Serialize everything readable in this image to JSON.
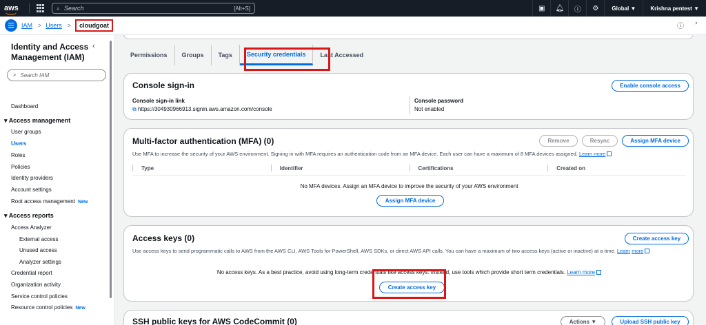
{
  "topbar": {
    "logo": "aws",
    "search_placeholder": "Search",
    "search_shortcut": "[Alt+S]",
    "region": "Global ▼",
    "account": "Krishna pentest ▼",
    "icons": [
      "terminal-icon",
      "bell-icon",
      "help-icon",
      "gear-icon"
    ]
  },
  "breadcrumb": {
    "items": [
      "IAM",
      "Users"
    ],
    "current": "cloudgoat",
    "separator": ">"
  },
  "sidebar": {
    "title": "Identity and Access Management (IAM)",
    "search_placeholder": "Search IAM",
    "dashboard": "Dashboard",
    "access_management": "Access management",
    "user_groups": "User groups",
    "users": "Users",
    "roles": "Roles",
    "policies": "Policies",
    "identity_providers": "Identity providers",
    "account_settings": "Account settings",
    "root_access": "Root access management",
    "new_badge": "New",
    "access_reports": "Access reports",
    "access_analyzer": "Access Analyzer",
    "external_access": "External access",
    "unused_access": "Unused access",
    "analyzer_settings": "Analyzer settings",
    "credential_report": "Credential report",
    "organization_activity": "Organization activity",
    "service_control_policies": "Service control policies",
    "resource_control_policies": "Resource control policies"
  },
  "tabs": [
    "Permissions",
    "Groups",
    "Tags",
    "Security credentials",
    "Last Accessed"
  ],
  "console": {
    "title": "Console sign-in",
    "enable_button": "Enable console access",
    "link_label": "Console sign-in link",
    "link_value": "https://304930966913.signin.aws.amazon.com/console",
    "password_label": "Console password",
    "password_value": "Not enabled"
  },
  "mfa": {
    "title": "Multi-factor authentication (MFA) (0)",
    "remove_button": "Remove",
    "resync_button": "Resync",
    "assign_button": "Assign MFA device",
    "description": "Use MFA to increase the security of your AWS environment. Signing in with MFA requires an authentication code from an MFA device. Each user can have a maximum of 8 MFA devices assigned.",
    "learn_more": "Learn more",
    "columns": [
      "Type",
      "Identifier",
      "Certifications",
      "Created on"
    ],
    "empty_text": "No MFA devices. Assign an MFA device to improve the security of your AWS environment",
    "empty_button": "Assign MFA device"
  },
  "access_keys": {
    "title": "Access keys (0)",
    "create_button": "Create access key",
    "description": "Use access keys to send programmatic calls to AWS from the AWS CLI, AWS Tools for PowerShell, AWS SDKs, or direct AWS API calls. You can have a maximum of two access keys (active or inactive) at a time.",
    "learn_more_1": "Learn",
    "learn_more_2": "more",
    "empty_text": "No access keys. As a best practice, avoid using long-term credentials like access keys. Instead, use tools which provide short term credentials.",
    "empty_learn_more": "Learn more",
    "empty_button": "Create access key"
  },
  "ssh": {
    "title": "SSH public keys for AWS CodeCommit (0)",
    "actions_button": "Actions ▼",
    "upload_button": "Upload SSH public key"
  },
  "colors": {
    "accent": "#006ce0",
    "highlight": "#d91515",
    "topbar": "#161d26"
  }
}
